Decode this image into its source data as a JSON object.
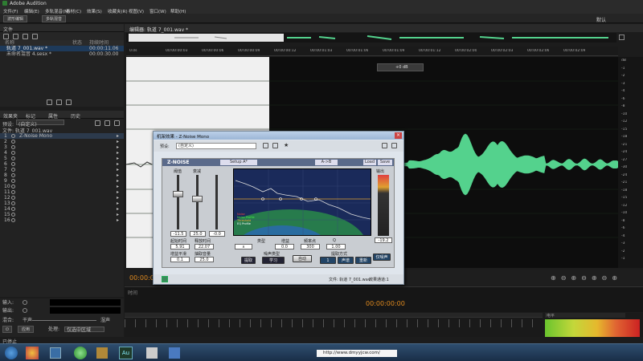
{
  "window": {
    "title": "Adobe Audition"
  },
  "menu": [
    "文件(F)",
    "编辑(E)",
    "多轨混音(M)",
    "素材(C)",
    "效果(S)",
    "收藏夹(R)",
    "视图(V)",
    "窗口(W)",
    "帮助(H)"
  ],
  "toolbar": {
    "waveform_label": "波形编辑",
    "multitrack_label": "多轨混音",
    "workspace_right": "默认"
  },
  "files_panel": {
    "title": "文件",
    "columns": [
      "名称",
      "状态",
      "持续时间"
    ],
    "items": [
      {
        "name": "轨道 7_001.wav *",
        "duration": "00:00:11.06"
      },
      {
        "name": "未命名混音 4.sesx *",
        "duration": "00:00:30.00"
      }
    ]
  },
  "effects_rack": {
    "tabs": [
      "效果夹",
      "标记",
      "属性",
      "历史"
    ],
    "preset_label": "预设:",
    "preset_value": "(自定义)",
    "file_label": "文件: 轨道 7_001.wav",
    "slot_numbers": [
      "1",
      "2",
      "3",
      "4",
      "5",
      "6",
      "7",
      "8",
      "9",
      "10",
      "11",
      "12",
      "13",
      "14",
      "15",
      "16"
    ],
    "slot1_name": "Z-Noise Mono",
    "input_label": "输入:",
    "output_label": "输出:",
    "mix_label": "混合:",
    "mix_value": "干声",
    "wet_value": "湿声",
    "apply_label": "应用",
    "process_label": "处理:",
    "process_value": "仅选中区域"
  },
  "editor": {
    "tab_title": "编辑器: 轨道 7_001.wav *",
    "timecodes": [
      "0.0s",
      "00:00:00:03",
      "00:00:00:06",
      "00:00:00:09",
      "00:00:00:12",
      "00:00:01:03",
      "00:00:01:06",
      "00:00:01:09",
      "00:00:01:12",
      "00:00:02:00",
      "00:00:02:03",
      "00:00:02:06",
      "00:00:02:09"
    ],
    "hud_value": "+0 dB",
    "db_scale": [
      "dB",
      "-1",
      "-2",
      "-3",
      "-4",
      "-6",
      "-8",
      "-10",
      "-12",
      "-15",
      "-18",
      "-21",
      "-24",
      "-27",
      "-30",
      "-24",
      "-21",
      "-18",
      "-15",
      "-12",
      "-10",
      "-8",
      "-6",
      "-4",
      "-3",
      "-2",
      "-1"
    ],
    "time_display": "00:00:00:00",
    "selection_time": "00:00:00:00"
  },
  "dialog": {
    "title": "机架效果 - Z-Noise Mono",
    "preset_label": "预设:",
    "preset_value": "(自定义)",
    "plugin_name": "Z-NOISE",
    "setup_label": "Setup A*",
    "load_label": "Load",
    "save_label": "Save",
    "abc_label": "A->B",
    "slider_labels": [
      "阈值",
      "衰减"
    ],
    "slider_values": [
      "-11.5",
      "25.0",
      "-0.0"
    ],
    "output_label": "输出",
    "output_value": "-19.2",
    "attack_label": "起始时间",
    "release_label": "释放时间",
    "attack_value": "5.91",
    "release_value": "22.07",
    "smooth_label": "增益平滑",
    "extract_label": "抽取音量",
    "smooth_value": "0.1",
    "extract_value": "25.0",
    "plot_legend": [
      "Noise",
      "Noise Profile",
      "Threshold",
      "EQ Profile"
    ],
    "band_headers": [
      "类型",
      "增益",
      "频率点",
      "Q"
    ],
    "band_values": [
      "0.0",
      "300",
      "1.00"
    ],
    "profile_label": "噪声类型",
    "extract_btn": "提取",
    "learn_btn": "学习",
    "noise_only": "仅噪声",
    "auto_label": "自动",
    "mode_label": "提取方式",
    "mode_btns": [
      "1",
      "声谱",
      "重新"
    ],
    "status_left": "文件: 轨道 7_001.wav",
    "status_right": "效果通道:1"
  },
  "level_meter": {
    "label": "电平"
  },
  "taskbar": {
    "url": "http://www.dmyyjcw.com/",
    "clock": "已停止",
    "app_label": "Au"
  },
  "colors": {
    "waveform": "#54d28d",
    "accent": "#1a6fb0",
    "background": "#1c1c1c"
  }
}
